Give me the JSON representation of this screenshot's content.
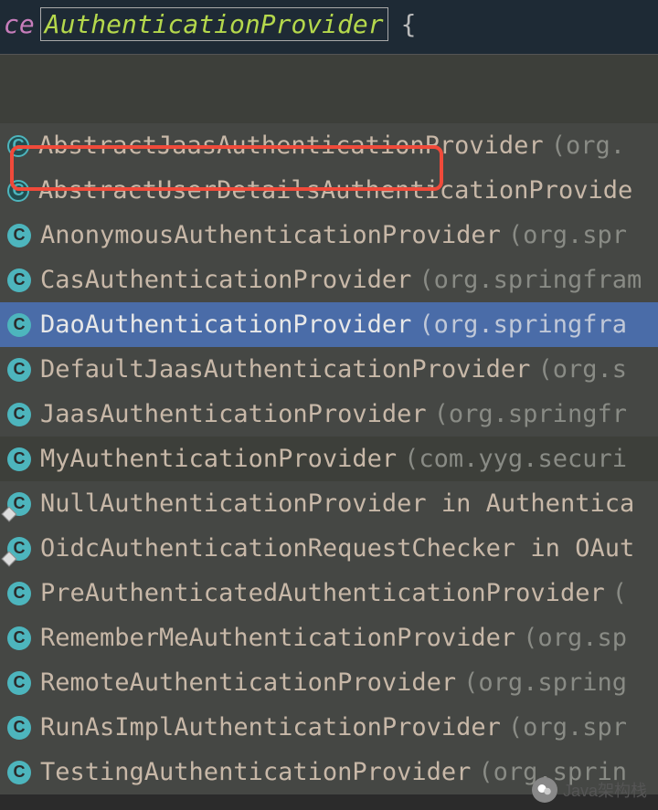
{
  "code": {
    "prefix": "ce",
    "className": "AuthenticationProvider",
    "brace": "{"
  },
  "completions": [
    {
      "name": "AbstractJaasAuthenticationProvider",
      "pkg": "(org.",
      "abstract": true,
      "badge": false
    },
    {
      "name": "AbstractUserDetailsAuthenticationProvide",
      "pkg": "",
      "abstract": true,
      "badge": false
    },
    {
      "name": "AnonymousAuthenticationProvider",
      "pkg": "(org.spr",
      "abstract": false,
      "badge": false
    },
    {
      "name": "CasAuthenticationProvider",
      "pkg": "(org.springfram",
      "abstract": false,
      "badge": false
    },
    {
      "name": "DaoAuthenticationProvider",
      "pkg": "(org.springfra",
      "abstract": false,
      "badge": false,
      "selected": true
    },
    {
      "name": "DefaultJaasAuthenticationProvider",
      "pkg": "(org.s",
      "abstract": false,
      "badge": false
    },
    {
      "name": "JaasAuthenticationProvider",
      "pkg": "(org.springfr",
      "abstract": false,
      "badge": false
    },
    {
      "name": "MyAuthenticationProvider",
      "pkg": "(com.yyg.securi",
      "abstract": false,
      "badge": false,
      "alt": true
    },
    {
      "name": "NullAuthenticationProvider in Authentica",
      "pkg": "",
      "abstract": false,
      "badge": true
    },
    {
      "name": "OidcAuthenticationRequestChecker in OAut",
      "pkg": "",
      "abstract": false,
      "badge": true
    },
    {
      "name": "PreAuthenticatedAuthenticationProvider",
      "pkg": "(",
      "abstract": false,
      "badge": false
    },
    {
      "name": "RememberMeAuthenticationProvider",
      "pkg": "(org.sp",
      "abstract": false,
      "badge": false
    },
    {
      "name": "RemoteAuthenticationProvider",
      "pkg": "(org.spring",
      "abstract": false,
      "badge": false
    },
    {
      "name": "RunAsImplAuthenticationProvider",
      "pkg": "(org.spr",
      "abstract": false,
      "badge": false
    },
    {
      "name": "TestingAuthenticationProvider",
      "pkg": "(org.sprin",
      "abstract": false,
      "badge": false
    }
  ],
  "watermark": {
    "text": "Java架构栈"
  }
}
